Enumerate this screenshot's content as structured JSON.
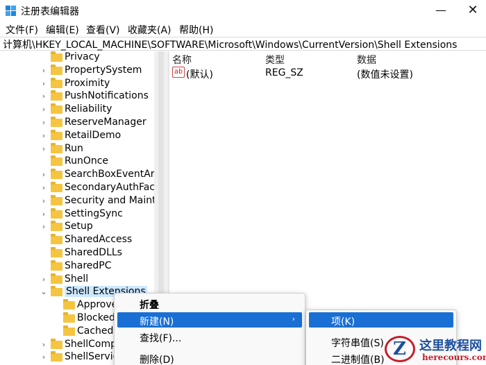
{
  "window": {
    "title": "注册表编辑器",
    "minimize_glyph": "—",
    "close_glyph": "✕"
  },
  "menubar": {
    "file": "文件(F)",
    "edit": "编辑(E)",
    "view": "查看(V)",
    "favorites": "收藏夹(A)",
    "help": "帮助(H)"
  },
  "address": {
    "path": "计算机\\HKEY_LOCAL_MACHINE\\SOFTWARE\\Microsoft\\Windows\\CurrentVersion\\Shell Extensions"
  },
  "tree": {
    "items": [
      {
        "label": "Privacy",
        "expandable": false
      },
      {
        "label": "PropertySystem",
        "expandable": true
      },
      {
        "label": "Proximity",
        "expandable": true
      },
      {
        "label": "PushNotifications",
        "expandable": true
      },
      {
        "label": "Reliability",
        "expandable": true
      },
      {
        "label": "ReserveManager",
        "expandable": true
      },
      {
        "label": "RetailDemo",
        "expandable": true
      },
      {
        "label": "Run",
        "expandable": true
      },
      {
        "label": "RunOnce",
        "expandable": false
      },
      {
        "label": "SearchBoxEventArgs",
        "expandable": true
      },
      {
        "label": "SecondaryAuthFacto",
        "expandable": true
      },
      {
        "label": "Security and Mainte",
        "expandable": true
      },
      {
        "label": "SettingSync",
        "expandable": true
      },
      {
        "label": "Setup",
        "expandable": true
      },
      {
        "label": "SharedAccess",
        "expandable": false
      },
      {
        "label": "SharedDLLs",
        "expandable": false
      },
      {
        "label": "SharedPC",
        "expandable": false
      },
      {
        "label": "Shell",
        "expandable": true
      },
      {
        "label": "Shell Extensions",
        "expandable": true,
        "expanded": true,
        "selected": true
      },
      {
        "label": "Approve",
        "expandable": false,
        "child": true
      },
      {
        "label": "Blocked",
        "expandable": false,
        "child": true
      },
      {
        "label": "Cached",
        "expandable": false,
        "child": true
      },
      {
        "label": "ShellComp",
        "expandable": true
      },
      {
        "label": "ShellServic",
        "expandable": true
      }
    ]
  },
  "values": {
    "headers": {
      "name": "名称",
      "type": "类型",
      "data": "数据"
    },
    "rows": [
      {
        "icon": "ab",
        "name": "(默认)",
        "type": "REG_SZ",
        "data": "(数值未设置)"
      }
    ]
  },
  "context_menu": {
    "collapse": "折叠",
    "new": "新建(N)",
    "new_arrow": "›",
    "find": "查找(F)...",
    "delete": "删除(D)"
  },
  "submenu": {
    "key": "项(K)",
    "string_value": "字符串值(S)",
    "binary_value": "二进制值(B)"
  },
  "watermark": {
    "letter": "Z",
    "title": "这里教程网",
    "url": "herecours.com"
  },
  "colors": {
    "accent": "#1a6fd4",
    "selection": "#cce8ff",
    "folder": "#f5c542"
  }
}
